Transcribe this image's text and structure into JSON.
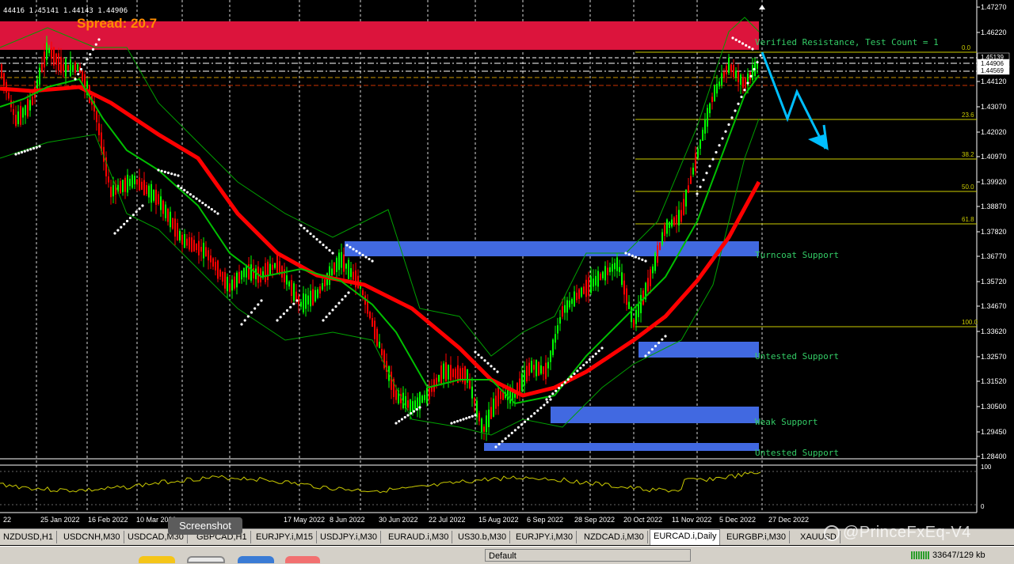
{
  "chart": {
    "ohlc_header": "44416 1.45141 1.44143 1.44906",
    "spread_label": "Spread: 20.7",
    "symbol": "EURCAD.i,Daily",
    "price_axis": [
      "1.47270",
      "1.46220",
      "1.45139",
      "1.44906",
      "1.44569",
      "1.44120",
      "1.43070",
      "1.42020",
      "1.40970",
      "1.39920",
      "1.38870",
      "1.37820",
      "1.36770",
      "1.35720",
      "1.34670",
      "1.33620",
      "1.32570",
      "1.31520",
      "1.30500",
      "1.29450",
      "1.28400"
    ],
    "price_tag_current": "1.44906",
    "price_tag_high": "1.45139",
    "price_tag_low": "1.44569",
    "date_axis": [
      "22",
      "25 Jan 2022",
      "16 Feb 2022",
      "10 Mar 2022",
      "",
      "17 May 2022",
      "8 Jun 2022",
      "30 Jun 2022",
      "22 Jul 2022",
      "15 Aug 2022",
      "6 Sep 2022",
      "28 Sep 2022",
      "20 Oct 2022",
      "11 Nov 2022",
      "5 Dec 2022",
      "27 Dec 2022"
    ],
    "fib_levels": [
      "0.0",
      "23.6",
      "38.2",
      "50.0",
      "61.8",
      "100.0"
    ],
    "zones": [
      {
        "label": "Verified Resistance, Test Count = 1",
        "color": "#dc143c"
      },
      {
        "label": "Turncoat Support",
        "color": "#4169e1"
      },
      {
        "label": "Untested Support",
        "color": "#4169e1"
      },
      {
        "label": "Weak Support",
        "color": "#4169e1"
      },
      {
        "label": "Untested Support",
        "color": "#4169e1"
      }
    ],
    "indicator_axis": [
      "100",
      "0"
    ],
    "colors": {
      "bull": "#00ff00",
      "bear": "#ff0000",
      "ma_slow": "#ff0000",
      "ma_fast": "#00c000",
      "fib": "#cccc00",
      "arrow": "#00bfff",
      "spread": "#ff8c00",
      "label": "#33cc66",
      "osc": "#cccc00"
    }
  },
  "tabs": [
    {
      "label": "NZDUSD,H1",
      "active": false
    },
    {
      "label": "USDCNH,M30",
      "active": false
    },
    {
      "label": "USDCAD,M30",
      "active": false
    },
    {
      "label": "GBPCAD,H1",
      "active": false
    },
    {
      "label": "EURJPY.i,M15",
      "active": false
    },
    {
      "label": "USDJPY.i,M30",
      "active": false
    },
    {
      "label": "EURAUD.i,M30",
      "active": false
    },
    {
      "label": "US30.b,M30",
      "active": false
    },
    {
      "label": "EURJPY.i,M30",
      "active": false
    },
    {
      "label": "NZDCAD.i,M30",
      "active": false
    },
    {
      "label": "EURCAD.i,Daily",
      "active": true
    },
    {
      "label": "EURGBP.i,M30",
      "active": false
    },
    {
      "label": "XAUUSD",
      "active": false
    }
  ],
  "status": {
    "profile": "Default",
    "traffic": "33647/129 kb"
  },
  "tooltip": "Screenshot",
  "watermark": "@PrinceFxEq-V4",
  "icons": {
    "screenshot": "screenshot-icon",
    "traffic": "connection-bars-icon"
  }
}
